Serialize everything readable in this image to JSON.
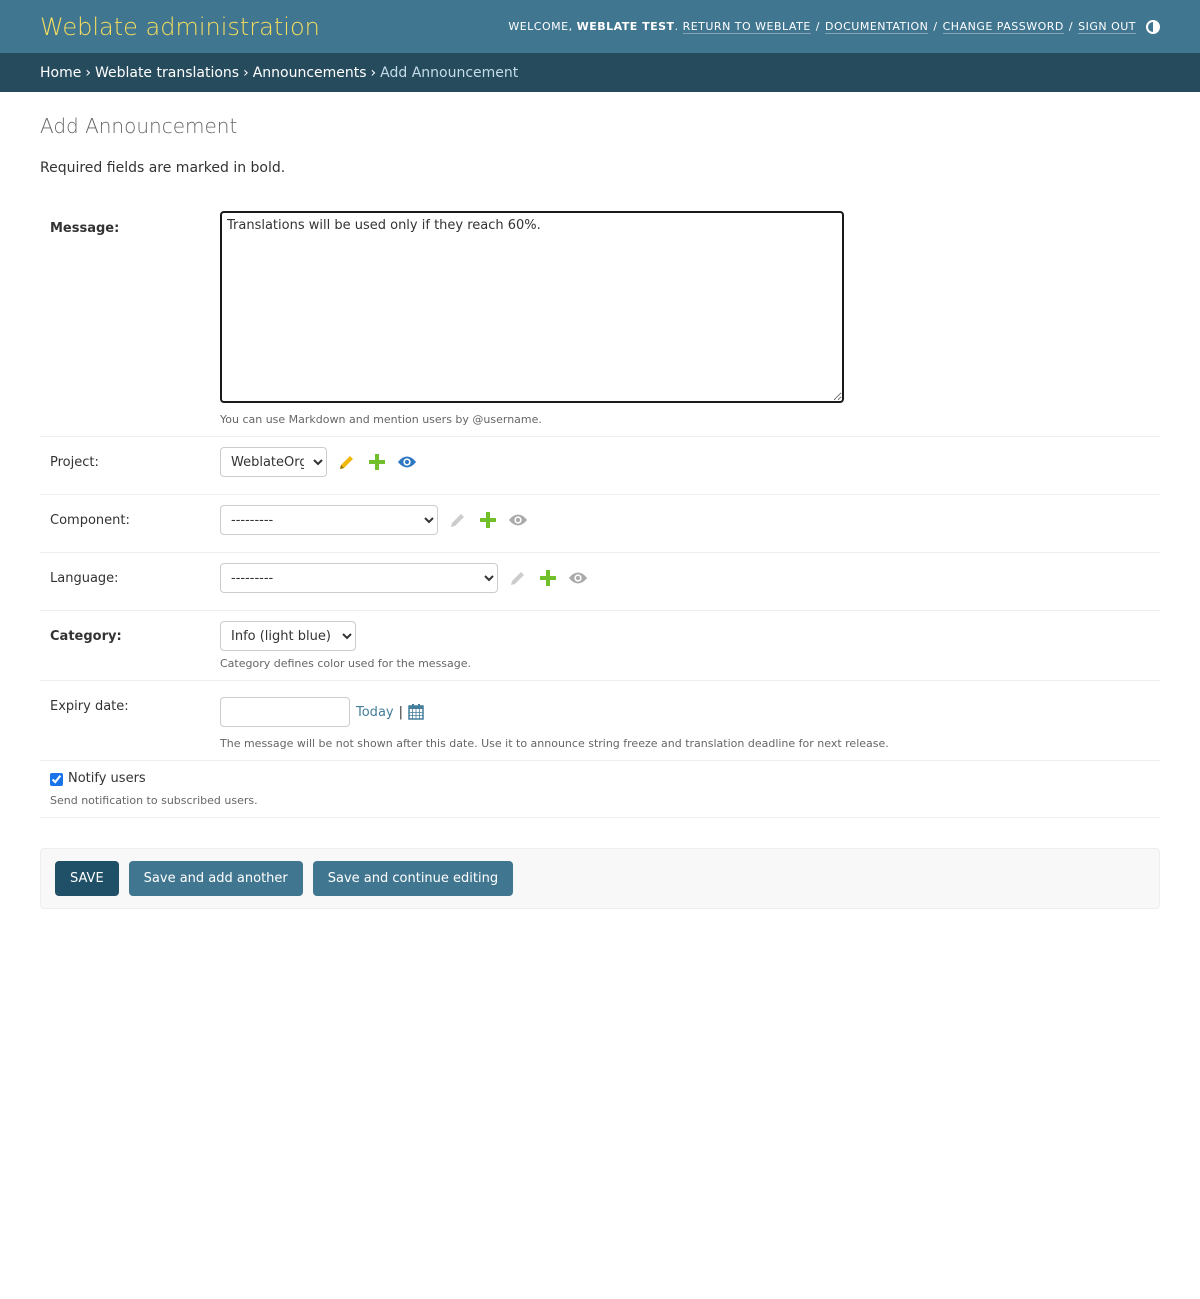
{
  "header": {
    "title": "Weblate administration",
    "welcome": "WELCOME,",
    "username": "WEBLATE TEST",
    "links": {
      "return": "RETURN TO WEBLATE",
      "docs": "DOCUMENTATION",
      "password": "CHANGE PASSWORD",
      "signout": "SIGN OUT"
    }
  },
  "breadcrumbs": {
    "home": "Home",
    "app": "Weblate translations",
    "model": "Announcements",
    "current": "Add Announcement"
  },
  "page": {
    "title": "Add Announcement",
    "note": "Required fields are marked in bold."
  },
  "form": {
    "message": {
      "label": "Message:",
      "value": "Translations will be used only if they reach 60%.",
      "help": "You can use Markdown and mention users by @username."
    },
    "project": {
      "label": "Project:",
      "selected": "WeblateOrg"
    },
    "component": {
      "label": "Component:",
      "selected": "---------"
    },
    "language": {
      "label": "Language:",
      "selected": "---------"
    },
    "category": {
      "label": "Category:",
      "selected": "Info (light blue)",
      "help": "Category defines color used for the message."
    },
    "expiry": {
      "label": "Expiry date:",
      "today": "Today",
      "separator": "|",
      "help": "The message will be not shown after this date. Use it to announce string freeze and translation deadline for next release."
    },
    "notify": {
      "label": "Notify users",
      "checked": true,
      "help": "Send notification to subscribed users."
    }
  },
  "buttons": {
    "save": "Save",
    "save_add": "Save and add another",
    "save_continue": "Save and continue editing"
  },
  "colors": {
    "header_bg": "#417690",
    "breadcrumb_bg": "#264b5d",
    "brand": "#f5dd5d",
    "edit_icon_active": "#efb80b",
    "add_icon": "#70bf2b",
    "view_icon_active": "#2e77c2",
    "icon_disabled": "#bbbbbb"
  }
}
